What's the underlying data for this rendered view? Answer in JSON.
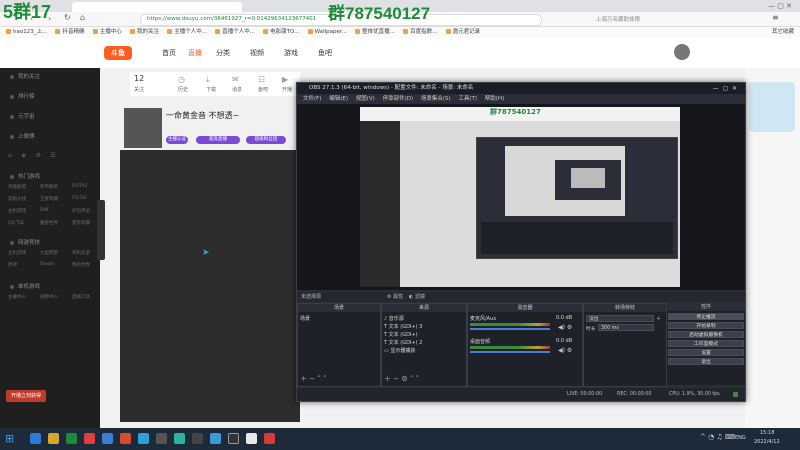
{
  "watermark": {
    "left": "5群17",
    "right": "群787540127"
  },
  "browser": {
    "url": "https://www.douyu.com/36461927_r=0.01429634123677401",
    "right_info": "上海万名娜助体限",
    "bookmarks": [
      "hao123_上...",
      "抖音精确",
      "主播中心",
      "我的关注",
      "主播个人中...",
      "直播个人中...",
      "电影康TO...",
      "Wallpaper...",
      "整体优直播...",
      "百度指数...",
      "邀元君记录"
    ],
    "bookmarks_right": "其它收藏"
  },
  "site": {
    "logo": "斗鱼",
    "nav": [
      "首页",
      "直播",
      "分类",
      "视频",
      "游戏",
      "鱼吧"
    ],
    "header_icons": [
      {
        "count": "12",
        "label": "关注"
      },
      {
        "label": "历史"
      },
      {
        "label": "下载"
      },
      {
        "label": "消息"
      },
      {
        "label": "鱼吧"
      },
      {
        "label": "开播"
      }
    ]
  },
  "sidebar": {
    "items": [
      "我的关注",
      "排行榜",
      "元宇宙",
      "上微博"
    ],
    "sections": [
      "热门游戏",
      "网游竞技",
      "单机游戏"
    ],
    "grid1": [
      "英雄联盟",
      "和平精英",
      "DOTA2",
      "穿越火线",
      "王者荣耀",
      "CS:GO",
      "主机游戏",
      "DNF",
      "炉石传说",
      "QQ飞车",
      "魔兽世界",
      "星际争霸"
    ],
    "grid2": [
      "主机游戏",
      "大型网游",
      "单机热游",
      "原神",
      "Steam",
      "我的世界"
    ],
    "grid3": [
      "主播中心",
      "视频中心",
      "直播工具"
    ],
    "footer": "开播立刻获得"
  },
  "room": {
    "title": "一命黄金音 不想透~",
    "tag1": "主播认证",
    "tag2": "超高直播",
    "tag3": "超级粉丝团"
  },
  "obs": {
    "title": "OBS 27.1.3 (64-bit, windows) - 配置文件: 未命名 - 场景: 未命名",
    "menu": [
      "文件(F)",
      "编辑(E)",
      "视图(V)",
      "停靠部件(D)",
      "场景集合(S)",
      "工具(T)",
      "帮助(H)"
    ],
    "preview_watermark": "群787540127",
    "source_bar": {
      "label": "未选择源",
      "props": "属性",
      "filters": "滤镜"
    },
    "docks": {
      "scenes": {
        "title": "场景",
        "items": [
          "场景"
        ]
      },
      "sources": {
        "title": "来源",
        "items": [
          "音乐源",
          "文本 (GDI+) 3",
          "文本 (GDI+)",
          "文本 (GDI+) 2",
          "显示器捕获"
        ]
      },
      "mixer": {
        "title": "混音器",
        "channels": [
          {
            "name": "麦克风/Aux",
            "level": "0.0 dB"
          },
          {
            "name": "桌面音频",
            "level": "0.0 dB"
          }
        ]
      },
      "transitions": {
        "title": "转场特效",
        "type": "淡出",
        "duration_label": "时长",
        "duration": "300 ms"
      },
      "controls": {
        "title": "控件",
        "buttons": [
          "停止推流",
          "开始录制",
          "启动虚拟摄像机",
          "工作室模式",
          "设置",
          "退出"
        ]
      }
    },
    "status": {
      "live": "LIVE: 00:00:00",
      "rec": "REC: 00:00:00",
      "cpu": "CPU: 1.9%, 30.00 fps"
    }
  },
  "taskbar": {
    "time": "15:18",
    "date": "2022/4/12",
    "lang": "ENG"
  },
  "colors": {
    "accent": "#ff5d23",
    "obs_bg": "#2b2e38",
    "watermark": "#1f8a3a"
  }
}
